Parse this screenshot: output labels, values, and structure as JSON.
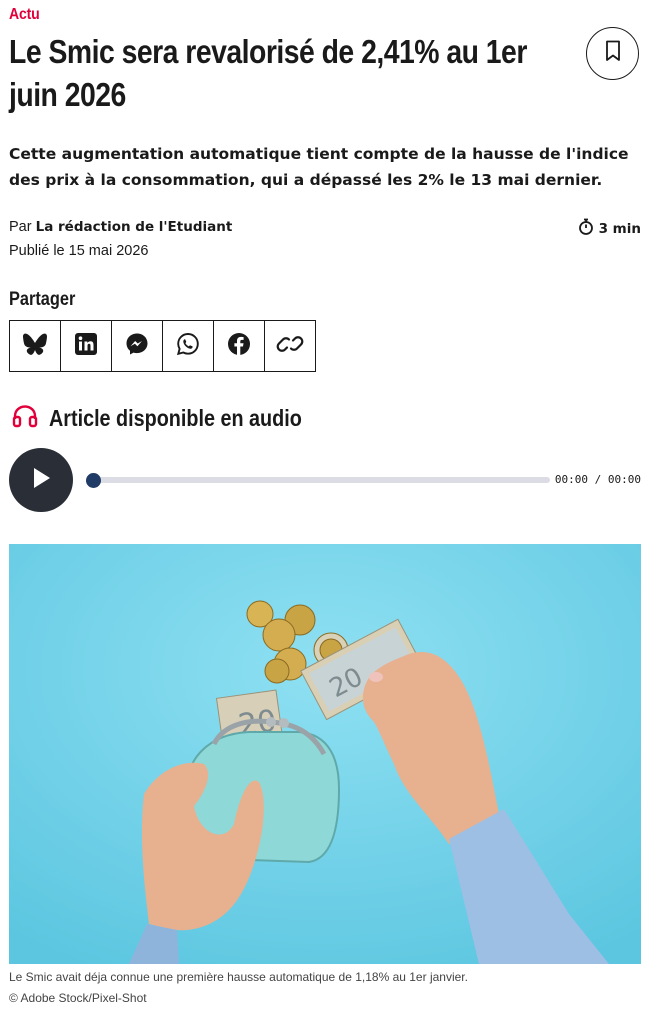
{
  "article": {
    "category": "Actu",
    "title": "Le Smic sera revalorisé de 2,41% au 1er juin 2026",
    "lead": "Cette augmentation automatique tient compte de la hausse de l'indice des prix à la consommation, qui a dépassé les 2% le 13 mai dernier.",
    "byline_prefix": "Par",
    "author": "La rédaction de l'Etudiant",
    "published": "Publié le 15 mai 2026",
    "read_time": "3 min"
  },
  "share": {
    "label": "Partager",
    "buttons": [
      "bluesky-icon",
      "linkedin-icon",
      "messenger-icon",
      "whatsapp-icon",
      "facebook-icon",
      "link-icon"
    ]
  },
  "audio": {
    "title": "Article disponible en audio",
    "time": "00:00 / 00:00",
    "progress": 0
  },
  "image": {
    "caption": "Le Smic avait déja connue une première hausse automatique de 1,18% au 1er janvier.",
    "credit": "© Adobe Stock/Pixel-Shot"
  },
  "colors": {
    "accent": "#e2003b",
    "player": "#2a2e36",
    "thumb": "#1f3b66"
  }
}
